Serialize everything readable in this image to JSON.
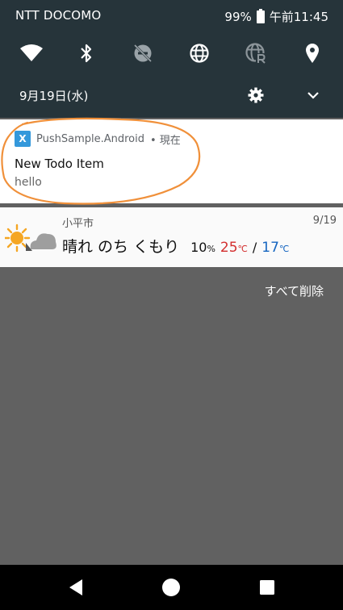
{
  "status_bar": {
    "carrier": "NTT DOCOMO",
    "battery": "99%",
    "time": "午前11:45"
  },
  "quick_settings": [
    {
      "name": "wifi-icon"
    },
    {
      "name": "bluetooth-icon"
    },
    {
      "name": "dnd-off-icon"
    },
    {
      "name": "globe-icon"
    },
    {
      "name": "roaming-icon"
    },
    {
      "name": "location-icon"
    }
  ],
  "header": {
    "date": "9月19日(水)"
  },
  "notification": {
    "app_name": "PushSample.Android",
    "when": "• 現在",
    "title": "New Todo Item",
    "text": "hello",
    "app_icon_glyph": "X",
    "highlight_color": "#f0903a"
  },
  "weather": {
    "city": "小平市",
    "date": "9/19",
    "condition": "晴れ のち くもり",
    "precip": "10",
    "precip_unit": "%",
    "high": "25",
    "high_unit": "℃",
    "separator": "/",
    "low": "17",
    "low_unit": "℃",
    "colors": {
      "high": "#d32f2f",
      "low": "#1565c0"
    }
  },
  "actions": {
    "clear_all": "すべて削除"
  },
  "nav": [
    "back-icon",
    "home-icon",
    "recents-icon"
  ]
}
